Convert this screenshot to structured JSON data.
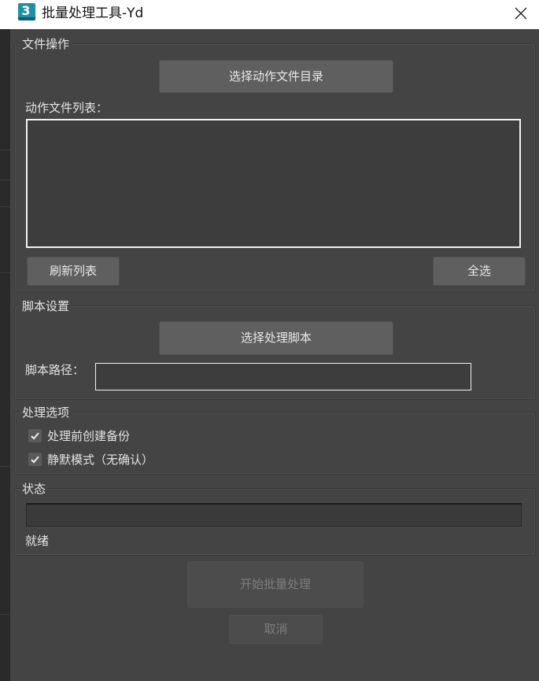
{
  "window": {
    "title": "批量处理工具-Yd",
    "icon_glyph": "3"
  },
  "file_ops": {
    "group_label": "文件操作",
    "select_dir_button": "选择动作文件目录",
    "list_label": "动作文件列表：",
    "files": [],
    "refresh_button": "刷新列表",
    "select_all_button": "全选"
  },
  "script_settings": {
    "group_label": "脚本设置",
    "select_script_button": "选择处理脚本",
    "path_label": "脚本路径：",
    "path_value": ""
  },
  "options": {
    "group_label": "处理选项",
    "backup_label": "处理前创建备份",
    "backup_checked": true,
    "silent_label": "静默模式（无确认）",
    "silent_checked": true
  },
  "status": {
    "group_label": "状态",
    "progress_percent": 0,
    "status_text": "就绪"
  },
  "actions": {
    "start_button": "开始批量处理",
    "cancel_button": "取消"
  }
}
